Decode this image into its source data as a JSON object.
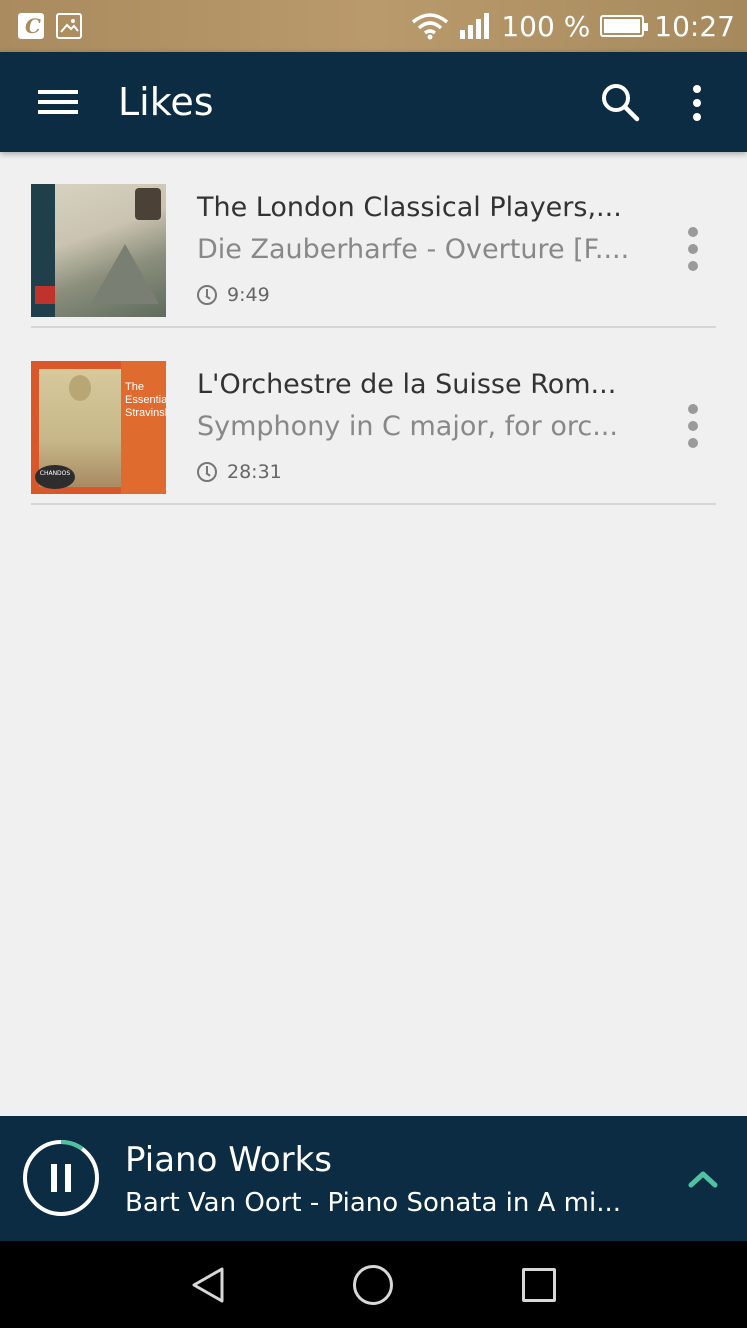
{
  "status_bar": {
    "battery_percent": "100 %",
    "time": "10:27"
  },
  "app_bar": {
    "title": "Likes"
  },
  "tracks": [
    {
      "artist": "The London Classical Players,...",
      "title": "Die Zauberharfe - Overture [F....",
      "duration": "9:49"
    },
    {
      "artist": "L'Orchestre de la Suisse Rom...",
      "title": "Symphony in C major, for orc...",
      "duration": "28:31"
    }
  ],
  "now_playing": {
    "title": "Piano Works",
    "subtitle": "Bart Van Oort - Piano Sonata in A mi...",
    "progress": 0.1,
    "accent_color": "#4fc3a1"
  },
  "colors": {
    "app_bar": "#0b2c43",
    "background": "#f0f0f0",
    "status_bar": "#a98b5f"
  }
}
